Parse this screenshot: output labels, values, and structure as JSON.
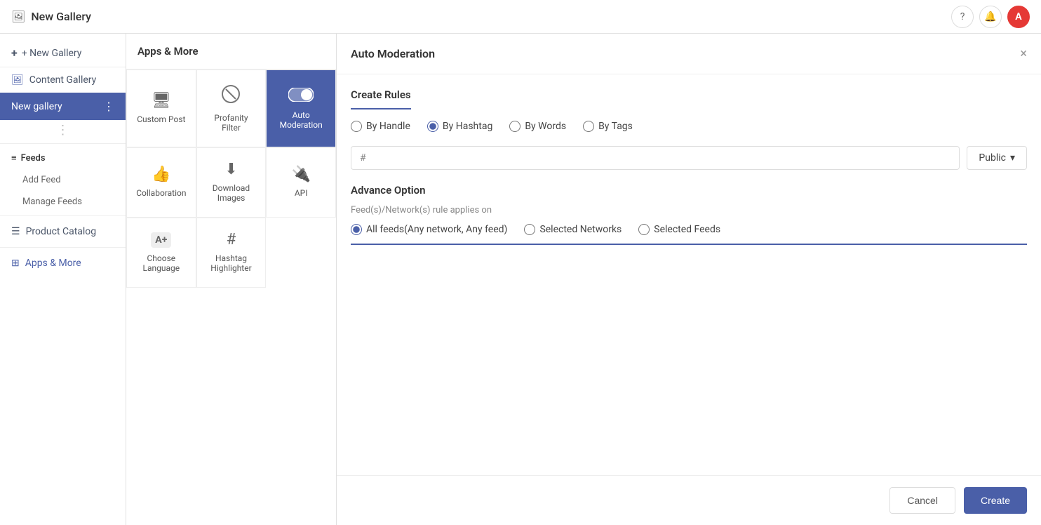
{
  "topbar": {
    "title": "New Gallery",
    "icon": "🖼",
    "help_label": "?",
    "bell_label": "🔔",
    "avatar_label": "A"
  },
  "sidebar": {
    "new_gallery_btn": "+ New Gallery",
    "content_gallery_label": "Content Gallery",
    "new_gallery_item": "New gallery",
    "feeds_label": "Feeds",
    "add_feed": "Add Feed",
    "manage_feeds": "Manage Feeds",
    "product_catalog": "Product Catalog",
    "apps_more": "Apps & More",
    "three_dots": "⋮",
    "feeds_icon": "≡",
    "product_icon": "☰",
    "apps_icon": "⊞"
  },
  "apps_panel": {
    "title": "Apps & More",
    "items": [
      {
        "id": "custom-post",
        "icon": "🖥",
        "label": "Custom Post",
        "active": false
      },
      {
        "id": "profanity-filter",
        "icon": "🚫",
        "label": "Profanity Filter",
        "active": false
      },
      {
        "id": "auto-moderation",
        "icon": "toggle",
        "label": "Auto Moderation",
        "active": true
      },
      {
        "id": "collaboration",
        "icon": "👍",
        "label": "Collaboration",
        "active": false
      },
      {
        "id": "download-images",
        "icon": "⬇",
        "label": "Download Images",
        "active": false
      },
      {
        "id": "api",
        "icon": "🔌",
        "label": "API",
        "active": false
      },
      {
        "id": "choose-language",
        "icon": "Az",
        "label": "Choose Language",
        "active": false
      },
      {
        "id": "hashtag-highlighter",
        "icon": "#",
        "label": "Hashtag Highlighter",
        "active": false
      }
    ]
  },
  "modal": {
    "title": "Auto Moderation",
    "close_label": "×",
    "create_rules_label": "Create Rules",
    "radio_options": [
      {
        "id": "by-handle",
        "label": "By Handle",
        "checked": false
      },
      {
        "id": "by-hashtag",
        "label": "By Hashtag",
        "checked": true
      },
      {
        "id": "by-words",
        "label": "By Words",
        "checked": false
      },
      {
        "id": "by-tags",
        "label": "By Tags",
        "checked": false
      }
    ],
    "hashtag_prefix": "#",
    "hashtag_placeholder": "",
    "public_label": "Public",
    "advance_option_label": "Advance Option",
    "feeds_network_label": "Feed(s)/Network(s) rule applies on",
    "feeds_radio_options": [
      {
        "id": "all-feeds",
        "label": "All feeds(Any network, Any feed)",
        "checked": true
      },
      {
        "id": "selected-networks",
        "label": "Selected Networks",
        "checked": false
      },
      {
        "id": "selected-feeds",
        "label": "Selected Feeds",
        "checked": false
      }
    ],
    "cancel_label": "Cancel",
    "create_label": "Create"
  },
  "colors": {
    "accent": "#4a5fa8",
    "active_bg": "#4a5fa8",
    "border": "#e0e0e0",
    "text_muted": "#888"
  }
}
